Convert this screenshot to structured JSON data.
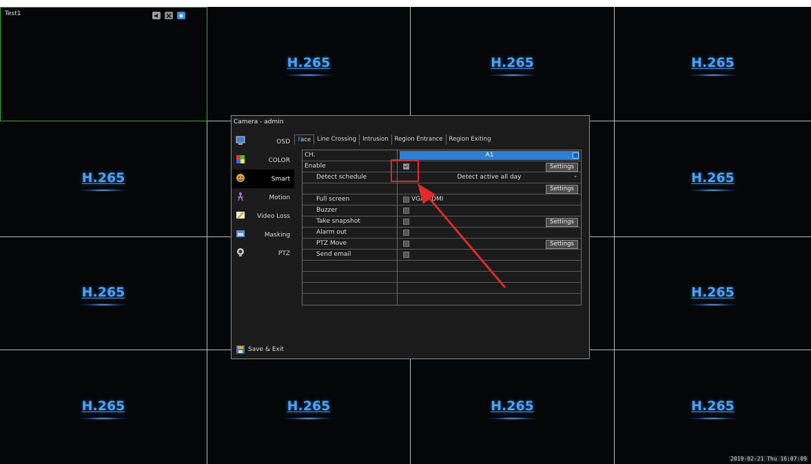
{
  "camera_grid": {
    "cells": [
      {
        "logo": ""
      },
      {
        "logo": "H.265"
      },
      {
        "logo": "H.265"
      },
      {
        "logo": "H.265"
      },
      {
        "logo": "H.265"
      },
      {
        "logo": ""
      },
      {
        "logo": ""
      },
      {
        "logo": "H.265"
      },
      {
        "logo": "H.265"
      },
      {
        "logo": ""
      },
      {
        "logo": ""
      },
      {
        "logo": "H.265"
      },
      {
        "logo": "H.265"
      },
      {
        "logo": "H.265"
      },
      {
        "logo": "H.265"
      },
      {
        "logo": "H.265"
      }
    ],
    "first_camera_name": "Test1",
    "timestamp": "2019-02-21 Thu 16:07:09",
    "toolbar_icons": [
      "speaker-icon",
      "close-icon",
      "camera-icon"
    ]
  },
  "dialog": {
    "title": "Camera - admin",
    "sidebar": [
      {
        "label": "OSD",
        "icon": "monitor-icon"
      },
      {
        "label": "COLOR",
        "icon": "color-palette-icon"
      },
      {
        "label": "Smart",
        "icon": "smart-face-icon"
      },
      {
        "label": "Motion",
        "icon": "motion-icon"
      },
      {
        "label": "Video Loss",
        "icon": "video-loss-icon"
      },
      {
        "label": "Masking",
        "icon": "masking-icon"
      },
      {
        "label": "PTZ",
        "icon": "ptz-icon"
      }
    ],
    "save_exit": "Save & Exit",
    "tabs": [
      {
        "first": "F",
        "rest": "ace",
        "selected": true
      },
      {
        "first": "",
        "rest": "Line Crossing",
        "selected": false
      },
      {
        "first": "",
        "rest": "Intrusion",
        "selected": false
      },
      {
        "first": "",
        "rest": "Region Entrance",
        "selected": false
      },
      {
        "first": "",
        "rest": "Region Exiting",
        "selected": false
      }
    ],
    "rows": {
      "channel": {
        "label": "CH.",
        "value": "A1"
      },
      "enable": {
        "label": "Enable",
        "checked": true,
        "settings": "Settings"
      },
      "schedule": {
        "label": "Detect schedule",
        "value": "Detect active all day"
      },
      "blank_settings": {
        "settings": "Settings"
      },
      "full_screen": {
        "label": "Full screen",
        "value": "VGA/HDMI"
      },
      "buzzer": {
        "label": "Buzzer"
      },
      "snapshot": {
        "label": "Take snapshot",
        "settings": "Settings"
      },
      "alarm_out": {
        "label": "Alarm out"
      },
      "ptz_move": {
        "label": "PTZ Move",
        "settings": "Settings"
      },
      "send_email": {
        "label": "Send email"
      }
    }
  },
  "colors": {
    "accent_blue": "#2f7fd2",
    "annotation_red": "#e2282a",
    "active_border": "#3fae3f"
  }
}
